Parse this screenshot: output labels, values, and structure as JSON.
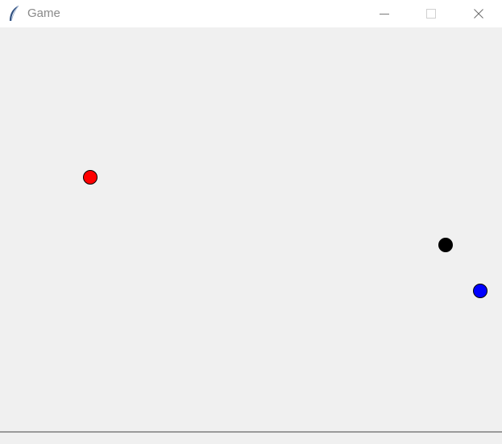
{
  "window": {
    "title": "Game",
    "app_icon": "feather-icon",
    "controls": {
      "minimize_icon": "minimize-icon",
      "maximize_icon": "maximize-icon",
      "close_icon": "close-icon"
    }
  },
  "canvas": {
    "background": "#f0f0f0",
    "balls": [
      {
        "name": "red-ball",
        "color": "#ff0000"
      },
      {
        "name": "black-ball",
        "color": "#000000"
      },
      {
        "name": "blue-ball",
        "color": "#0000ff"
      }
    ]
  }
}
